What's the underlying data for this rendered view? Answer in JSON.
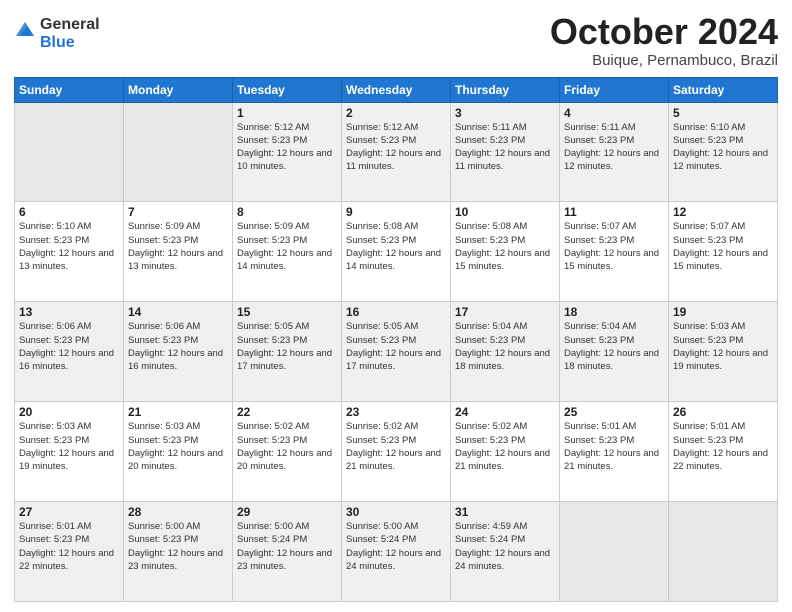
{
  "logo": {
    "general": "General",
    "blue": "Blue"
  },
  "header": {
    "month": "October 2024",
    "location": "Buique, Pernambuco, Brazil"
  },
  "weekdays": [
    "Sunday",
    "Monday",
    "Tuesday",
    "Wednesday",
    "Thursday",
    "Friday",
    "Saturday"
  ],
  "weeks": [
    [
      {
        "day": "",
        "empty": true
      },
      {
        "day": "",
        "empty": true
      },
      {
        "day": "1",
        "sunrise": "5:12 AM",
        "sunset": "5:23 PM",
        "daylight": "12 hours and 10 minutes."
      },
      {
        "day": "2",
        "sunrise": "5:12 AM",
        "sunset": "5:23 PM",
        "daylight": "12 hours and 11 minutes."
      },
      {
        "day": "3",
        "sunrise": "5:11 AM",
        "sunset": "5:23 PM",
        "daylight": "12 hours and 11 minutes."
      },
      {
        "day": "4",
        "sunrise": "5:11 AM",
        "sunset": "5:23 PM",
        "daylight": "12 hours and 12 minutes."
      },
      {
        "day": "5",
        "sunrise": "5:10 AM",
        "sunset": "5:23 PM",
        "daylight": "12 hours and 12 minutes."
      }
    ],
    [
      {
        "day": "6",
        "sunrise": "5:10 AM",
        "sunset": "5:23 PM",
        "daylight": "12 hours and 13 minutes."
      },
      {
        "day": "7",
        "sunrise": "5:09 AM",
        "sunset": "5:23 PM",
        "daylight": "12 hours and 13 minutes."
      },
      {
        "day": "8",
        "sunrise": "5:09 AM",
        "sunset": "5:23 PM",
        "daylight": "12 hours and 14 minutes."
      },
      {
        "day": "9",
        "sunrise": "5:08 AM",
        "sunset": "5:23 PM",
        "daylight": "12 hours and 14 minutes."
      },
      {
        "day": "10",
        "sunrise": "5:08 AM",
        "sunset": "5:23 PM",
        "daylight": "12 hours and 15 minutes."
      },
      {
        "day": "11",
        "sunrise": "5:07 AM",
        "sunset": "5:23 PM",
        "daylight": "12 hours and 15 minutes."
      },
      {
        "day": "12",
        "sunrise": "5:07 AM",
        "sunset": "5:23 PM",
        "daylight": "12 hours and 15 minutes."
      }
    ],
    [
      {
        "day": "13",
        "sunrise": "5:06 AM",
        "sunset": "5:23 PM",
        "daylight": "12 hours and 16 minutes."
      },
      {
        "day": "14",
        "sunrise": "5:06 AM",
        "sunset": "5:23 PM",
        "daylight": "12 hours and 16 minutes."
      },
      {
        "day": "15",
        "sunrise": "5:05 AM",
        "sunset": "5:23 PM",
        "daylight": "12 hours and 17 minutes."
      },
      {
        "day": "16",
        "sunrise": "5:05 AM",
        "sunset": "5:23 PM",
        "daylight": "12 hours and 17 minutes."
      },
      {
        "day": "17",
        "sunrise": "5:04 AM",
        "sunset": "5:23 PM",
        "daylight": "12 hours and 18 minutes."
      },
      {
        "day": "18",
        "sunrise": "5:04 AM",
        "sunset": "5:23 PM",
        "daylight": "12 hours and 18 minutes."
      },
      {
        "day": "19",
        "sunrise": "5:03 AM",
        "sunset": "5:23 PM",
        "daylight": "12 hours and 19 minutes."
      }
    ],
    [
      {
        "day": "20",
        "sunrise": "5:03 AM",
        "sunset": "5:23 PM",
        "daylight": "12 hours and 19 minutes."
      },
      {
        "day": "21",
        "sunrise": "5:03 AM",
        "sunset": "5:23 PM",
        "daylight": "12 hours and 20 minutes."
      },
      {
        "day": "22",
        "sunrise": "5:02 AM",
        "sunset": "5:23 PM",
        "daylight": "12 hours and 20 minutes."
      },
      {
        "day": "23",
        "sunrise": "5:02 AM",
        "sunset": "5:23 PM",
        "daylight": "12 hours and 21 minutes."
      },
      {
        "day": "24",
        "sunrise": "5:02 AM",
        "sunset": "5:23 PM",
        "daylight": "12 hours and 21 minutes."
      },
      {
        "day": "25",
        "sunrise": "5:01 AM",
        "sunset": "5:23 PM",
        "daylight": "12 hours and 21 minutes."
      },
      {
        "day": "26",
        "sunrise": "5:01 AM",
        "sunset": "5:23 PM",
        "daylight": "12 hours and 22 minutes."
      }
    ],
    [
      {
        "day": "27",
        "sunrise": "5:01 AM",
        "sunset": "5:23 PM",
        "daylight": "12 hours and 22 minutes."
      },
      {
        "day": "28",
        "sunrise": "5:00 AM",
        "sunset": "5:23 PM",
        "daylight": "12 hours and 23 minutes."
      },
      {
        "day": "29",
        "sunrise": "5:00 AM",
        "sunset": "5:24 PM",
        "daylight": "12 hours and 23 minutes."
      },
      {
        "day": "30",
        "sunrise": "5:00 AM",
        "sunset": "5:24 PM",
        "daylight": "12 hours and 24 minutes."
      },
      {
        "day": "31",
        "sunrise": "4:59 AM",
        "sunset": "5:24 PM",
        "daylight": "12 hours and 24 minutes."
      },
      {
        "day": "",
        "empty": true
      },
      {
        "day": "",
        "empty": true
      }
    ]
  ],
  "labels": {
    "sunrise_prefix": "Sunrise: ",
    "sunset_prefix": "Sunset: ",
    "daylight_prefix": "Daylight: "
  }
}
